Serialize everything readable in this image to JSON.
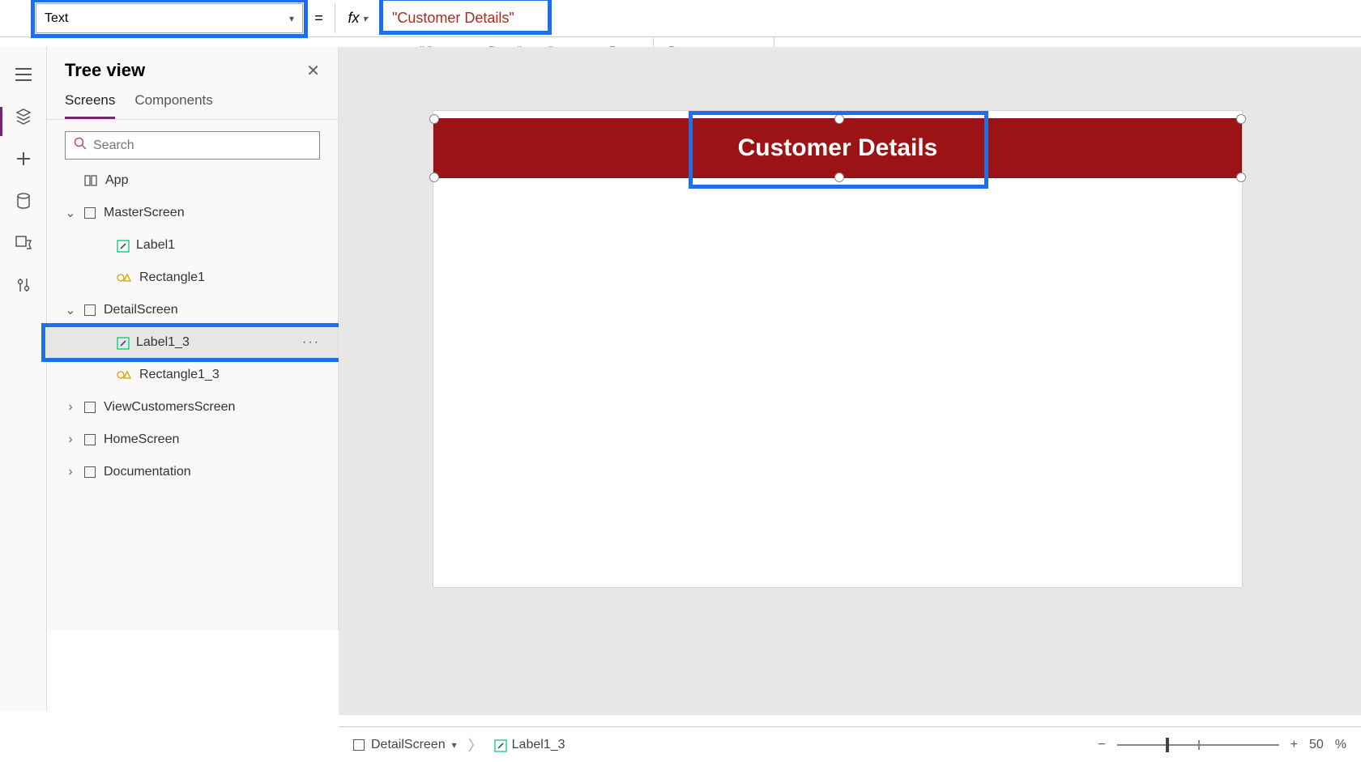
{
  "formulaBar": {
    "property": "Text",
    "equals": "=",
    "fx": "fx",
    "value": "\"Customer Details\""
  },
  "infoBar": {
    "leftQuoted": "\"Customer Deta\"",
    "leftEquals": "=",
    "leftResult": "Customer Deta",
    "dataTypeLabel": "Data type: ",
    "dataTypeValue": "text"
  },
  "treePanel": {
    "title": "Tree view",
    "tabs": {
      "screens": "Screens",
      "components": "Components"
    },
    "searchPlaceholder": "Search",
    "items": {
      "app": "App",
      "master": "MasterScreen",
      "label1": "Label1",
      "rectangle1": "Rectangle1",
      "detail": "DetailScreen",
      "label1_3": "Label1_3",
      "rectangle1_3": "Rectangle1_3",
      "viewCustomers": "ViewCustomersScreen",
      "home": "HomeScreen",
      "documentation": "Documentation",
      "ellipsis": "···"
    }
  },
  "canvas": {
    "headerText": "Customer Details"
  },
  "bottomBar": {
    "crumb1": "DetailScreen",
    "crumb2": "Label1_3",
    "zoomMinus": "−",
    "zoomPlus": "+",
    "zoomValue": "50",
    "zoomPct": "%"
  }
}
